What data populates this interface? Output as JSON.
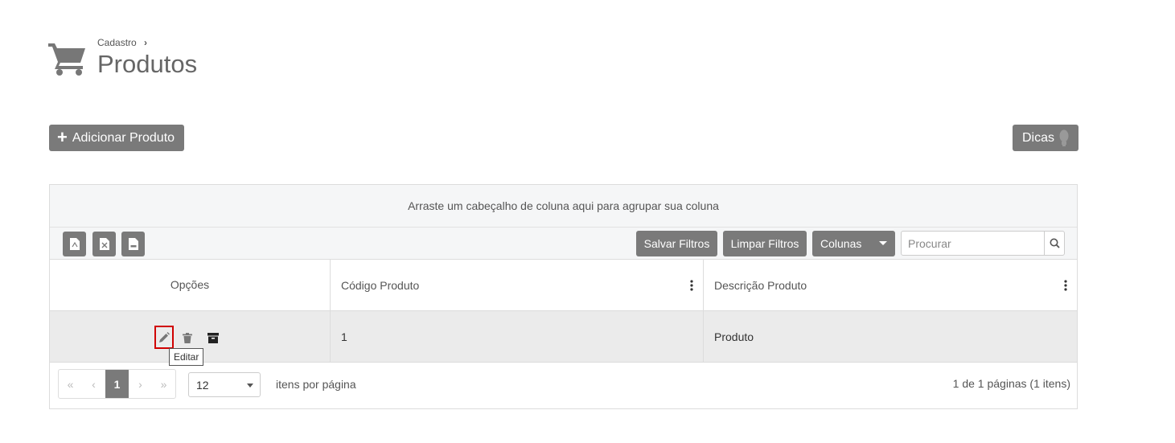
{
  "header": {
    "breadcrumb": "Cadastro",
    "breadcrumb_sep": "›",
    "title": "Produtos",
    "icon": "shopping-cart-icon"
  },
  "actions": {
    "add_label": "Adicionar Produto",
    "tips_label": "Dicas"
  },
  "grid": {
    "group_hint": "Arraste um cabeçalho de coluna aqui para agrupar sua coluna",
    "toolbar": {
      "export_icons": [
        "pdf-file-icon",
        "excel-file-icon",
        "csv-file-icon"
      ],
      "save_filters": "Salvar Filtros",
      "clear_filters": "Limpar Filtros",
      "columns": "Colunas",
      "search_placeholder": "Procurar"
    },
    "columns": [
      "Opções",
      "Código Produto",
      "Descrição Produto"
    ],
    "rows": [
      {
        "codigo": "1",
        "descricao": "Produto"
      }
    ],
    "row_actions": [
      "pencil-icon",
      "trash-icon",
      "archive-icon"
    ],
    "tooltip": "Editar",
    "pager": {
      "first": "«",
      "prev": "‹",
      "current": "1",
      "next": "›",
      "last": "»",
      "page_size": "12",
      "per_page_label": "itens por página",
      "info": "1 de 1 páginas (1 itens)"
    }
  },
  "colors": {
    "button_gray": "#7a7a7a",
    "panel_bg": "#f5f6f7",
    "row_bg": "#ebebeb",
    "highlight": "#d00000"
  }
}
